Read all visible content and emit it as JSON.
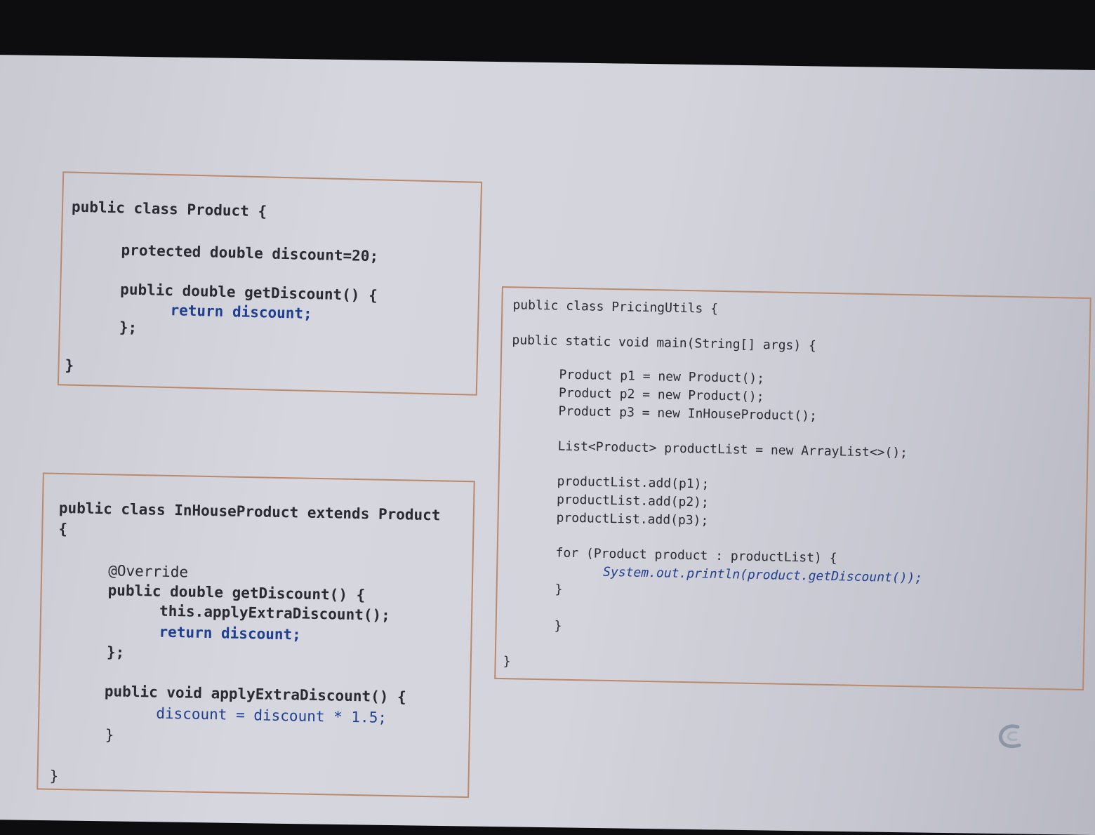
{
  "product_class": {
    "line1": "public class Product {",
    "line2": "protected double discount=20;",
    "line3": "public double getDiscount() {",
    "line4": "return discount;",
    "line5": "};",
    "line6": "}"
  },
  "inhouse_class": {
    "line1": "public class InHouseProduct extends Product",
    "line2": "{",
    "line3": "@Override",
    "line4": "public double getDiscount() {",
    "line5": "this.applyExtraDiscount();",
    "line6": "return discount;",
    "line7": "};",
    "line8": "public void applyExtraDiscount() {",
    "line9": "discount = discount * 1.5;",
    "line10": "}",
    "line11": "}"
  },
  "pricing_class": {
    "line1": "public class PricingUtils {",
    "line2": "public static void main(String[] args) {",
    "line3": "Product p1 = new Product();",
    "line4": "Product p2 = new Product();",
    "line5": "Product p3 = new InHouseProduct();",
    "line6": "List<Product> productList = new ArrayList<>();",
    "line7": "productList.add(p1);",
    "line8": "productList.add(p2);",
    "line9": "productList.add(p3);",
    "line10": "for (Product product : productList) {",
    "line11": "System.out.println(product.getDiscount());",
    "line12": "}",
    "line13": "}",
    "line14": "}"
  },
  "colors": {
    "border": "#b98a6c",
    "variable": "#1f3f8f",
    "text": "#2a2a34"
  },
  "icons": {
    "logo": "c-logo-icon"
  }
}
